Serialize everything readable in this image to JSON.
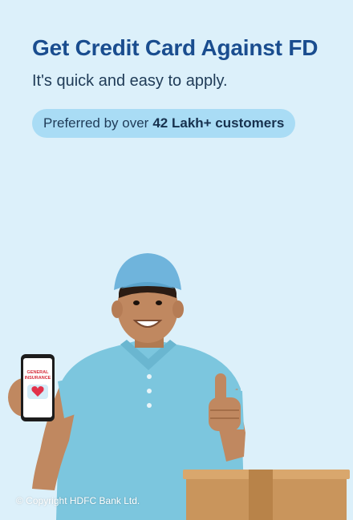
{
  "banner": {
    "title": "Get Credit Card Against FD",
    "subtitle": "It's quick and easy to apply.",
    "pill_prefix": "Preferred by over",
    "pill_highlight": "42 Lakh+ customers"
  },
  "phone_screen": {
    "line1": "GENERAL",
    "line2": "INSURANCE"
  },
  "footer": {
    "copyright": "© Copyright HDFC Bank Ltd."
  },
  "colors": {
    "background": "#dcf0fa",
    "title": "#1a4d8f",
    "pill": "#a9dcf5",
    "shirt": "#7cc6de",
    "cap": "#6fb4dc",
    "box": "#c9955c"
  }
}
